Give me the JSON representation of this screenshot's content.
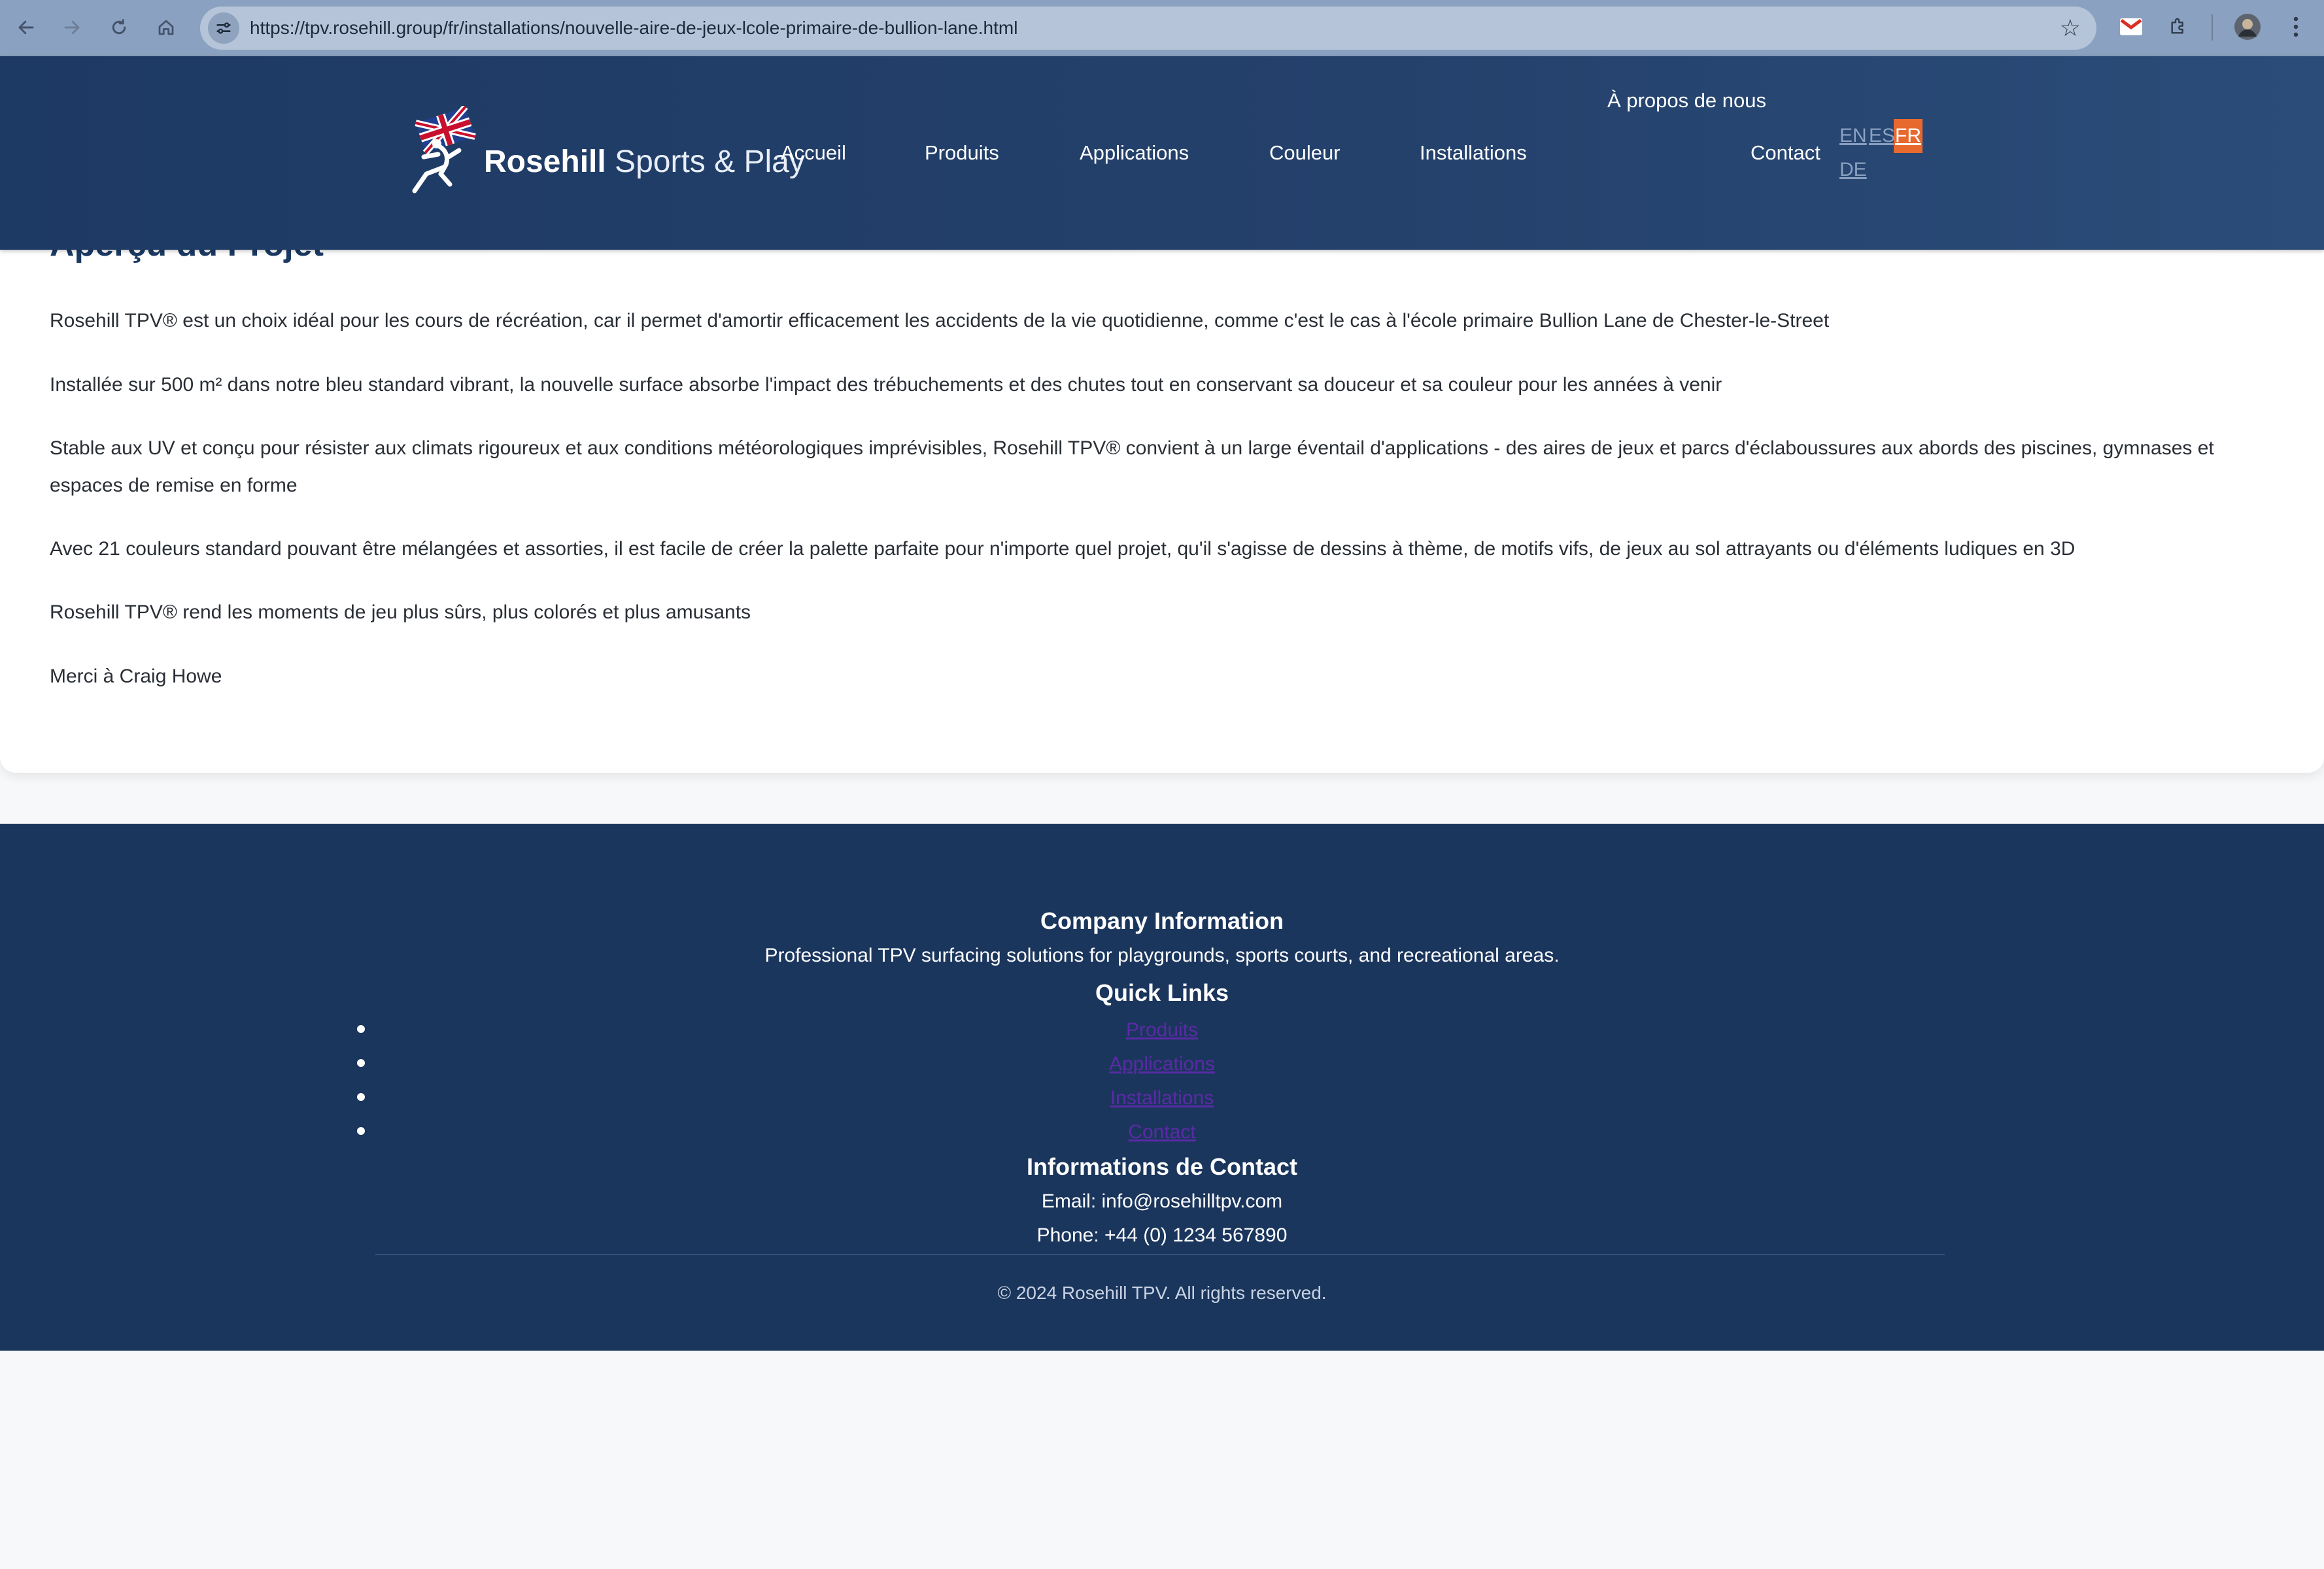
{
  "browser": {
    "url": "https://tpv.rosehill.group/fr/installations/nouvelle-aire-de-jeux-lcole-primaire-de-bullion-lane.html",
    "icons": [
      "back-icon",
      "forward-icon",
      "reload-icon",
      "home-icon",
      "site-info-icon",
      "star-icon",
      "gmail-icon",
      "extensions-icon",
      "profile-avatar-icon",
      "menu-kebab-icon"
    ]
  },
  "header": {
    "logo_bold": "Rosehill",
    "logo_light": "Sports & Play",
    "nav": {
      "accueil": "Accueil",
      "produits": "Produits",
      "applications": "Applications",
      "couleur": "Couleur",
      "installations": "Installations",
      "about": "À propos de nous",
      "contact": "Contact"
    },
    "languages": {
      "en": "EN",
      "es": "ES",
      "fr": "FR",
      "de": "DE"
    },
    "active_language": "FR"
  },
  "content": {
    "title": "Aperçu du Projet",
    "paragraphs": [
      "Rosehill TPV® est un choix idéal pour les cours de récréation, car il permet d'amortir efficacement les accidents de la vie quotidienne, comme c'est le cas à l'école primaire Bullion Lane de Chester-le-Street",
      "Installée sur 500 m² dans notre bleu standard vibrant, la nouvelle surface absorbe l'impact des trébuchements et des chutes tout en conservant sa douceur et sa couleur pour les années à venir",
      "Stable aux UV et conçu pour résister aux climats rigoureux et aux conditions météorologiques imprévisibles, Rosehill TPV® convient à un large éventail d'applications - des aires de jeux et parcs d'éclaboussures aux abords des piscines, gymnases et espaces de remise en forme",
      "Avec 21 couleurs standard pouvant être mélangées et assorties, il est facile de créer la palette parfaite pour n'importe quel projet, qu'il s'agisse de dessins à thème, de motifs vifs, de jeux au sol attrayants ou d'éléments ludiques en 3D",
      "Rosehill TPV® rend les moments de jeu plus sûrs, plus colorés et plus amusants",
      "Merci à Craig Howe"
    ]
  },
  "footer": {
    "company_heading": "Company Information",
    "company_text": "Professional TPV surfacing solutions for playgrounds, sports courts, and recreational areas.",
    "links_heading": "Quick Links",
    "links": [
      "Produits",
      "Applications",
      "Installations",
      "Contact"
    ],
    "contact_heading": "Informations de Contact",
    "email": "Email: info@rosehilltpv.com",
    "phone": "Phone: +44 (0) 1234 567890",
    "copyright": "© 2024 Rosehill TPV. All rights reserved."
  },
  "colors": {
    "header_bg": "#1d3a64",
    "footer_bg": "#1b365d",
    "title_color": "#1b3a63",
    "active_lang_bg": "#e8692e",
    "link_visited": "#5b2aa6"
  }
}
